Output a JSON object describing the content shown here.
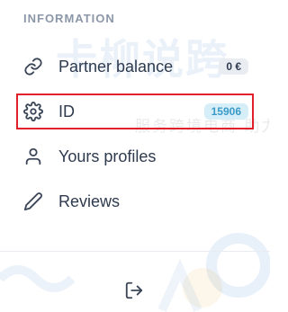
{
  "section": {
    "title": "INFORMATION"
  },
  "menu": {
    "items": [
      {
        "label": "Partner balance",
        "icon": "link-icon",
        "badge": "0 €"
      },
      {
        "label": "ID",
        "icon": "gear-icon",
        "badge": "15906"
      },
      {
        "label": "Yours profiles",
        "icon": "user-icon"
      },
      {
        "label": "Reviews",
        "icon": "pencil-icon"
      }
    ]
  },
  "watermark": {
    "main": "卡柳说跨",
    "sub": "服务跨境电商 助力中企出"
  },
  "footer": {
    "logout_icon": "logout-icon"
  },
  "colors": {
    "text": "#2e3a4e",
    "muted": "#8b97a8",
    "highlight": "#e0202a",
    "badge_blue_bg": "#d6eef8",
    "badge_blue_text": "#3a9bc8"
  }
}
